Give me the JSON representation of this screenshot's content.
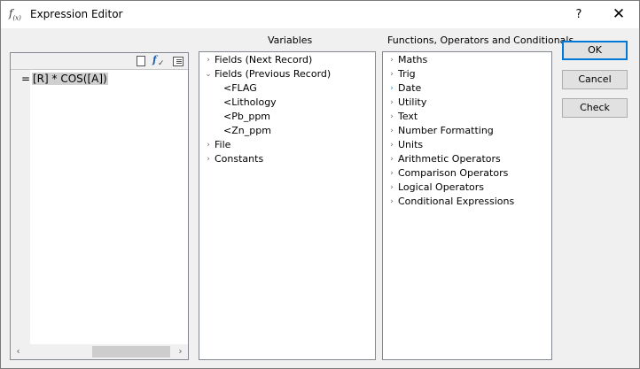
{
  "window": {
    "title": "Expression Editor",
    "icon_text": "f(x)",
    "help_label": "?",
    "close_label": "✕"
  },
  "editor": {
    "equals": "=",
    "expression": "[R] * COS([A])"
  },
  "variables": {
    "header": "Variables",
    "items": [
      {
        "label": "Fields (Next Record)",
        "expander": "›"
      },
      {
        "label": "Fields (Previous Record)",
        "expander": "⌄"
      },
      {
        "label": "<FLAG"
      },
      {
        "label": "<Lithology"
      },
      {
        "label": "<Pb_ppm"
      },
      {
        "label": "<Zn_ppm"
      },
      {
        "label": "File",
        "expander": "›"
      },
      {
        "label": "Constants",
        "expander": "›"
      }
    ]
  },
  "functions": {
    "header": "Functions, Operators and Conditionals",
    "items": [
      {
        "label": "Maths",
        "expander": "›"
      },
      {
        "label": "Trig",
        "expander": "›"
      },
      {
        "label": "Date",
        "expander": "›"
      },
      {
        "label": "Utility",
        "expander": "›"
      },
      {
        "label": "Text",
        "expander": "›"
      },
      {
        "label": "Number Formatting",
        "expander": "›"
      },
      {
        "label": "Units",
        "expander": "›"
      },
      {
        "label": "Arithmetic Operators",
        "expander": "›"
      },
      {
        "label": "Comparison Operators",
        "expander": "›"
      },
      {
        "label": "Logical Operators",
        "expander": "›"
      },
      {
        "label": "Conditional Expressions",
        "expander": "›"
      }
    ]
  },
  "buttons": {
    "ok": "OK",
    "cancel": "Cancel",
    "check": "Check"
  },
  "scroll": {
    "left_arrow": "‹",
    "right_arrow": "›"
  },
  "colors": {
    "accent": "#0078d7",
    "selected_chevron": "#1a9ad7"
  }
}
